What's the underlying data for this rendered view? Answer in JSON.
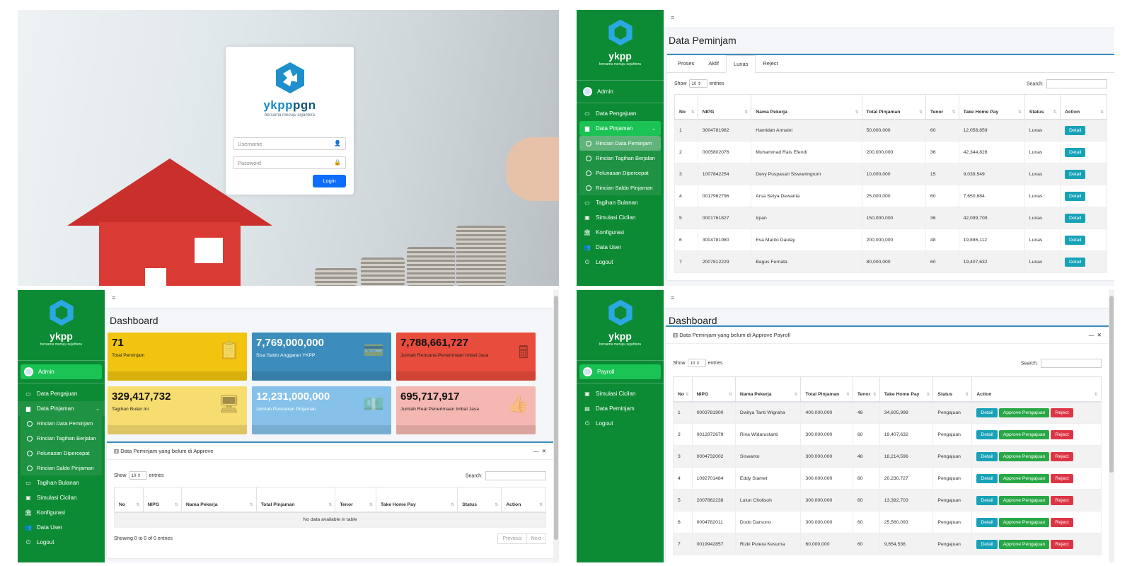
{
  "brand": {
    "part1": "ykpp",
    "part2": "pgn",
    "tagline": "bersama menuju sejahtera"
  },
  "login": {
    "username_placeholder": "Username",
    "password_placeholder": "Password",
    "button": "Login"
  },
  "topbar": {
    "menu_icon": "≡"
  },
  "admin_sidebar": {
    "user": "Admin",
    "items": [
      {
        "label": "Data Pengajuan",
        "icon": "card-icon"
      },
      {
        "label": "Data Pinjaman",
        "icon": "folder-icon"
      },
      {
        "label": "Tagihan Bulanan",
        "icon": "card-icon"
      },
      {
        "label": "Simulasi Cicilan",
        "icon": "money-icon"
      },
      {
        "label": "Konfigurasi",
        "icon": "bank-icon"
      },
      {
        "label": "Data User",
        "icon": "users-icon"
      },
      {
        "label": "Logout",
        "icon": "power-icon"
      }
    ],
    "subitems": [
      "Rincian Data Peminjam",
      "Rincian Tagihan Berjalan",
      "Pelunasan Dipercepat",
      "Rincian Saldo Pinjaman"
    ]
  },
  "payroll_sidebar": {
    "user": "Payroll",
    "items": [
      {
        "label": "Simulasi Cicilan"
      },
      {
        "label": "Data Peminjam"
      },
      {
        "label": "Logout"
      }
    ]
  },
  "peminjam": {
    "title": "Data Peminjam",
    "tabs": [
      "Proses",
      "Aktif",
      "Lunas",
      "Reject"
    ],
    "show": "Show",
    "entries": "entries",
    "search": "Search:",
    "pagesize": "10",
    "columns": [
      "No",
      "NIPG",
      "Nama Pekerja",
      "Total Pinjaman",
      "Tenor",
      "Take Home Pay",
      "Status",
      "Action"
    ],
    "rows": [
      [
        "1",
        "3004781982",
        "Hamidah Armaini",
        "50,000,000",
        "60",
        "12,058,859",
        "Lunas"
      ],
      [
        "2",
        "0005802076",
        "Muhammad Rais Efendi",
        "200,000,000",
        "36",
        "42,344,828",
        "Lunas"
      ],
      [
        "3",
        "1007842254",
        "Devy Puspasari Siswaningrum",
        "10,000,000",
        "15",
        "9,039,549",
        "Lunas"
      ],
      [
        "4",
        "0017962796",
        "Arsa Setya Dewanta",
        "25,000,000",
        "60",
        "7,650,884",
        "Lunas"
      ],
      [
        "5",
        "0001761827",
        "Irpan",
        "150,000,000",
        "36",
        "42,099,709",
        "Lunas"
      ],
      [
        "6",
        "3004781980",
        "Eva Marito Daulay",
        "200,000,000",
        "48",
        "19,886,112",
        "Lunas"
      ],
      [
        "7",
        "2007812229",
        "Bagus Fernata",
        "80,000,000",
        "60",
        "19,407,632",
        "Lunas"
      ]
    ],
    "detail": "Detail"
  },
  "dashboard": {
    "title": "Dashboard",
    "boxes": [
      {
        "value": "71",
        "label": "Total Peminjam",
        "color": "#f1c40f"
      },
      {
        "value": "7,769,000,000",
        "label": "Sisa Saldo Anggaran YKPP",
        "color": "#3c8dbc"
      },
      {
        "value": "7,788,661,727",
        "label": "Jumlah Rencana Penerimaan Imbal Jasa",
        "color": "#e74c3c"
      },
      {
        "value": "329,417,732",
        "label": "Tagihan Bulan Ini",
        "color": "#f7dc6f"
      },
      {
        "value": "12,231,000,000",
        "label": "Jumlah Pencairan Pinjaman",
        "color": "#85c1e9"
      },
      {
        "value": "695,717,917",
        "label": "Jumlah Real Penerimaan Imbal Jasa",
        "color": "#f5b7b1"
      }
    ],
    "card_title": "Data Peminjam yang belum di Approve",
    "columns": [
      "No",
      "NIPG",
      "Nama Pekerja",
      "Total Pinjaman",
      "Tenor",
      "Take Home Pay",
      "Status",
      "Action"
    ],
    "empty": "No data available in table",
    "showing": "Showing 0 to 0 of 0 entries",
    "prev": "Previous",
    "next": "Next"
  },
  "payroll": {
    "title": "Dashboard",
    "card_title": "Data Peminjam yang belum di Approve Payroll",
    "columns": [
      "No",
      "NIPG",
      "Nama Pekerja",
      "Total Pinjaman",
      "Tenor",
      "Take Home Pay",
      "Status",
      "Action"
    ],
    "rows": [
      [
        "1",
        "0003781900",
        "Dwitya Tanti Wigraha",
        "400,000,000",
        "48",
        "34,605,998",
        "Pengajuan"
      ],
      [
        "2",
        "0012872679",
        "Rina Widarustanti",
        "300,000,000",
        "60",
        "19,407,632",
        "Pengajuan"
      ],
      [
        "3",
        "0004732002",
        "Siswanto",
        "300,000,000",
        "48",
        "18,214,596",
        "Pengajuan"
      ],
      [
        "4",
        "1092701484",
        "Eddy Slamet",
        "300,000,000",
        "60",
        "20,230,727",
        "Pengajuan"
      ],
      [
        "5",
        "2007862238",
        "Lulun Cholisoh",
        "300,000,000",
        "60",
        "13,392,703",
        "Pengajuan"
      ],
      [
        "6",
        "0004782011",
        "Dodo Darsono",
        "300,000,000",
        "60",
        "25,560,093",
        "Pengajuan"
      ],
      [
        "7",
        "0019942857",
        "Rizki Putera Kesuma",
        "60,000,000",
        "60",
        "9,654,536",
        "Pengajuan"
      ]
    ],
    "detail": "Detail",
    "approve": "Approve Pengajuan",
    "reject": "Reject"
  }
}
